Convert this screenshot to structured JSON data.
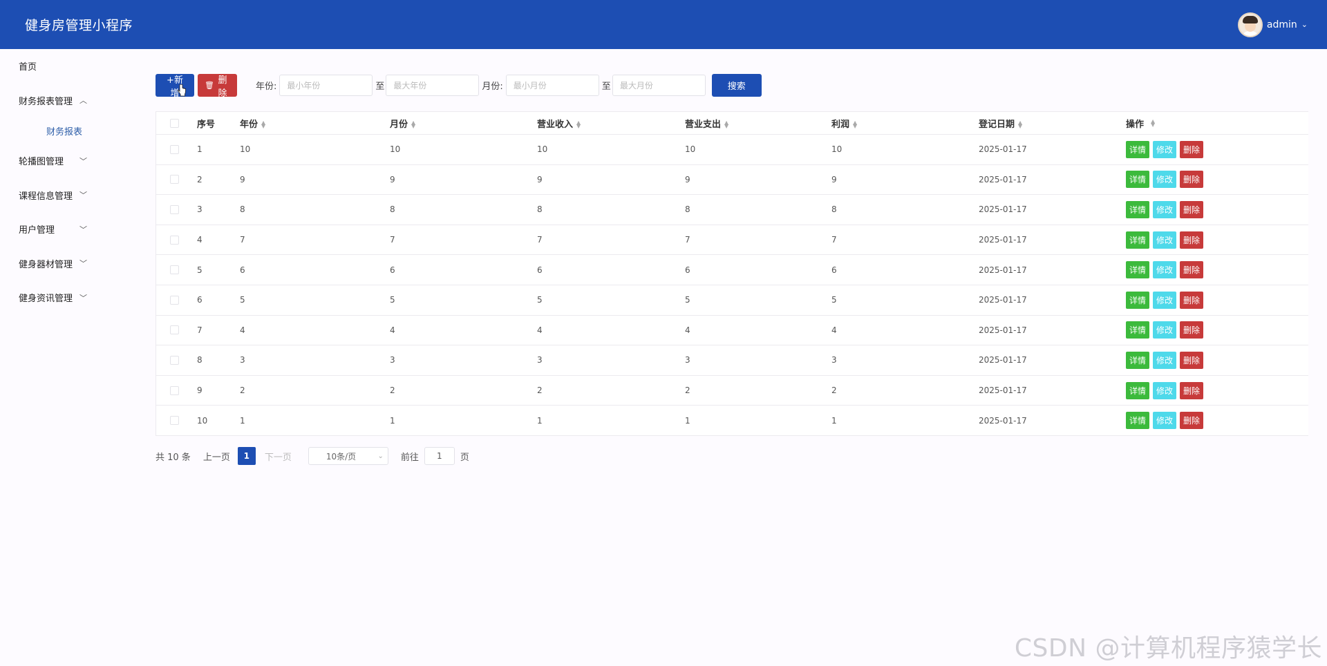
{
  "header": {
    "title": "健身房管理小程序",
    "username": "admin"
  },
  "sidebar": {
    "items": [
      {
        "label": "首页"
      },
      {
        "label": "财务报表管理",
        "expanded": true,
        "children": [
          {
            "label": "财务报表"
          }
        ]
      },
      {
        "label": "轮播图管理"
      },
      {
        "label": "课程信息管理"
      },
      {
        "label": "用户管理"
      },
      {
        "label": "健身器材管理"
      },
      {
        "label": "健身资讯管理"
      }
    ]
  },
  "toolbar": {
    "add_label": "+新增",
    "delete_label": "删除",
    "year_label": "年份:",
    "year_min_placeholder": "最小年份",
    "year_max_placeholder": "最大年份",
    "to_label": "至",
    "month_label": "月份:",
    "month_min_placeholder": "最小月份",
    "month_max_placeholder": "最大月份",
    "search_label": "搜索"
  },
  "table": {
    "headers": [
      "序号",
      "年份",
      "月份",
      "营业收入",
      "营业支出",
      "利润",
      "登记日期",
      "操作"
    ],
    "actions": {
      "detail": "详情",
      "edit": "修改",
      "delete": "删除"
    },
    "rows": [
      [
        "1",
        "10",
        "10",
        "10",
        "10",
        "10",
        "2025-01-17"
      ],
      [
        "2",
        "9",
        "9",
        "9",
        "9",
        "9",
        "2025-01-17"
      ],
      [
        "3",
        "8",
        "8",
        "8",
        "8",
        "8",
        "2025-01-17"
      ],
      [
        "4",
        "7",
        "7",
        "7",
        "7",
        "7",
        "2025-01-17"
      ],
      [
        "5",
        "6",
        "6",
        "6",
        "6",
        "6",
        "2025-01-17"
      ],
      [
        "6",
        "5",
        "5",
        "5",
        "5",
        "5",
        "2025-01-17"
      ],
      [
        "7",
        "4",
        "4",
        "4",
        "4",
        "4",
        "2025-01-17"
      ],
      [
        "8",
        "3",
        "3",
        "3",
        "3",
        "3",
        "2025-01-17"
      ],
      [
        "9",
        "2",
        "2",
        "2",
        "2",
        "2",
        "2025-01-17"
      ],
      [
        "10",
        "1",
        "1",
        "1",
        "1",
        "1",
        "2025-01-17"
      ]
    ]
  },
  "pagination": {
    "total": "共 10 条",
    "prev": "上一页",
    "current": "1",
    "next": "下一页",
    "page_size": "10条/页",
    "goto_label": "前往",
    "goto_value": "1",
    "page_suffix": "页"
  },
  "watermark": "CSDN @计算机程序猿学长",
  "colors": {
    "primary": "#1d4eb3",
    "danger": "#c73a3a",
    "success": "#3cba3c",
    "info": "#4ed9ea"
  }
}
